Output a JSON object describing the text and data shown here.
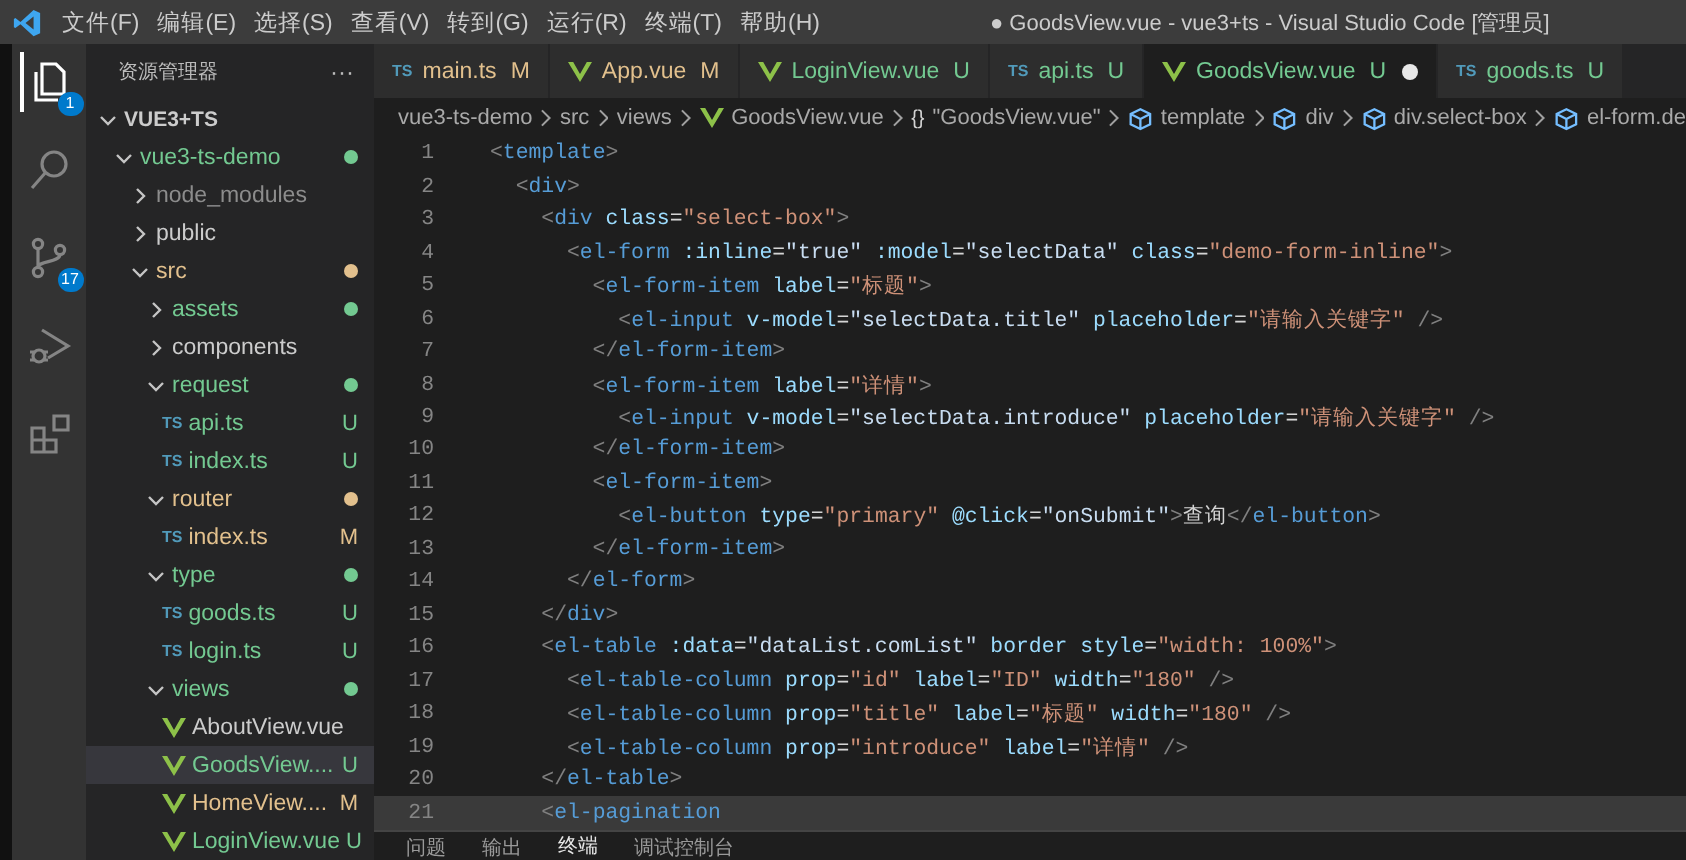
{
  "menu": [
    "文件(F)",
    "编辑(E)",
    "选择(S)",
    "查看(V)",
    "转到(G)",
    "运行(R)",
    "终端(T)",
    "帮助(H)"
  ],
  "window": {
    "title": "● GoodsView.vue - vue3+ts - Visual Studio Code [管理员]"
  },
  "activity_bar": [
    {
      "kind": "explorer",
      "badge": "1",
      "selected": true
    },
    {
      "kind": "search",
      "selected": false
    },
    {
      "kind": "source-control",
      "badge": "17",
      "selected": false
    },
    {
      "kind": "run",
      "selected": false
    },
    {
      "kind": "extensions",
      "selected": false
    }
  ],
  "explorer": {
    "title": "资源管理器",
    "more": "···",
    "tree": [
      {
        "name": "VUE3+TS",
        "kind": "root",
        "expanded": true,
        "selected": false,
        "children": [
          {
            "name": "vue3-ts-demo",
            "kind": "folder",
            "expanded": true,
            "color": "#73c991",
            "dot": true,
            "selected": false,
            "children": [
              {
                "name": "node_modules",
                "kind": "folder",
                "expanded": false,
                "color": "#8c8c8c",
                "dot": false,
                "selected": false
              },
              {
                "name": "public",
                "kind": "folder",
                "expanded": false,
                "color": "#cccccc",
                "dot": false,
                "selected": false
              },
              {
                "name": "src",
                "kind": "folder",
                "expanded": true,
                "color": "#e2c08d",
                "dot": true,
                "selected": false,
                "children": [
                  {
                    "name": "assets",
                    "kind": "folder",
                    "expanded": false,
                    "color": "#73c991",
                    "dot": true,
                    "selected": false
                  },
                  {
                    "name": "components",
                    "kind": "folder",
                    "expanded": false,
                    "color": "#cccccc",
                    "dot": false,
                    "selected": false
                  },
                  {
                    "name": "request",
                    "kind": "folder",
                    "expanded": true,
                    "color": "#73c991",
                    "dot": true,
                    "selected": false,
                    "children": [
                      {
                        "name": "api.ts",
                        "kind": "ts",
                        "icon_text": "TS",
                        "badge": "U",
                        "color": "#73c991",
                        "selected": false
                      },
                      {
                        "name": "index.ts",
                        "kind": "ts",
                        "icon_text": "TS",
                        "badge": "U",
                        "color": "#73c991",
                        "selected": false
                      }
                    ]
                  },
                  {
                    "name": "router",
                    "kind": "folder",
                    "expanded": true,
                    "color": "#e2c08d",
                    "dot": true,
                    "selected": false,
                    "children": [
                      {
                        "name": "index.ts",
                        "kind": "ts",
                        "icon_text": "TS",
                        "badge": "M",
                        "color": "#e2c08d",
                        "selected": false
                      }
                    ]
                  },
                  {
                    "name": "type",
                    "kind": "folder",
                    "expanded": true,
                    "color": "#73c991",
                    "dot": true,
                    "selected": false,
                    "children": [
                      {
                        "name": "goods.ts",
                        "kind": "ts",
                        "icon_text": "TS",
                        "badge": "U",
                        "color": "#73c991",
                        "selected": false
                      },
                      {
                        "name": "login.ts",
                        "kind": "ts",
                        "icon_text": "TS",
                        "badge": "U",
                        "color": "#73c991",
                        "selected": false
                      }
                    ]
                  },
                  {
                    "name": "views",
                    "kind": "folder",
                    "expanded": true,
                    "color": "#73c991",
                    "dot": true,
                    "selected": false,
                    "children": [
                      {
                        "name": "AboutView.vue",
                        "kind": "vue",
                        "color": "#cccccc",
                        "selected": false
                      },
                      {
                        "name": "GoodsView....",
                        "kind": "vue",
                        "badge": "U",
                        "color": "#73c991",
                        "selected": true
                      },
                      {
                        "name": "HomeView....",
                        "kind": "vue",
                        "badge": "M",
                        "color": "#e2c08d",
                        "selected": false
                      },
                      {
                        "name": "LoginView.vue",
                        "kind": "vue",
                        "badge": "U",
                        "color": "#73c991",
                        "selected": false
                      }
                    ]
                  }
                ]
              }
            ]
          }
        ]
      }
    ]
  },
  "tabs": [
    {
      "name": "main.ts",
      "kind": "ts",
      "icon_text": "TS",
      "badge": "M",
      "color": "#e2c08d",
      "selected": false,
      "modified": false
    },
    {
      "name": "App.vue",
      "kind": "vue",
      "badge": "M",
      "color": "#e2c08d",
      "selected": false,
      "modified": false
    },
    {
      "name": "LoginView.vue",
      "kind": "vue",
      "badge": "U",
      "color": "#73c991",
      "selected": false,
      "modified": false
    },
    {
      "name": "api.ts",
      "kind": "ts",
      "icon_text": "TS",
      "badge": "U",
      "color": "#73c991",
      "selected": false,
      "modified": false
    },
    {
      "name": "GoodsView.vue",
      "kind": "vue",
      "badge": "U",
      "color": "#73c991",
      "selected": true,
      "modified": true
    },
    {
      "name": "goods.ts",
      "kind": "ts",
      "icon_text": "TS",
      "badge": "U",
      "color": "#73c991",
      "selected": false,
      "modified": false
    }
  ],
  "breadcrumb": [
    {
      "text": "vue3-ts-demo",
      "kind": "plain"
    },
    {
      "text": "src",
      "kind": "plain"
    },
    {
      "text": "views",
      "kind": "plain"
    },
    {
      "text": "GoodsView.vue",
      "kind": "vue"
    },
    {
      "text": "\"GoodsView.vue\"",
      "kind": "braces",
      "icon_text": "{}"
    },
    {
      "text": "template",
      "kind": "element"
    },
    {
      "text": "div",
      "kind": "element"
    },
    {
      "text": "div.select-box",
      "kind": "element"
    },
    {
      "text": "el-form.de",
      "kind": "element"
    }
  ],
  "code": [
    {
      "number": "1",
      "highlighted": false,
      "tokens": [
        {
          "kind": "punct",
          "text": "<"
        },
        {
          "kind": "tag",
          "text": "template"
        },
        {
          "kind": "punct",
          "text": ">"
        }
      ]
    },
    {
      "number": "2",
      "highlighted": false,
      "tokens": [
        {
          "kind": "punct",
          "text": "  <"
        },
        {
          "kind": "tag",
          "text": "div"
        },
        {
          "kind": "punct",
          "text": ">"
        }
      ]
    },
    {
      "number": "3",
      "highlighted": false,
      "tokens": [
        {
          "kind": "punct",
          "text": "    <"
        },
        {
          "kind": "tag",
          "text": "div"
        },
        {
          "kind": "attr",
          "text": " class"
        },
        {
          "kind": "text",
          "text": "="
        },
        {
          "kind": "string",
          "text": "\"select-box\""
        },
        {
          "kind": "punct",
          "text": ">"
        }
      ]
    },
    {
      "number": "4",
      "highlighted": false,
      "tokens": [
        {
          "kind": "punct",
          "text": "      <"
        },
        {
          "kind": "tag",
          "text": "el-form"
        },
        {
          "kind": "attr",
          "text": " :inline"
        },
        {
          "kind": "text",
          "text": "="
        },
        {
          "kind": "expr",
          "text": "\"true\""
        },
        {
          "kind": "attr",
          "text": " :model"
        },
        {
          "kind": "text",
          "text": "="
        },
        {
          "kind": "expr",
          "text": "\"selectData\""
        },
        {
          "kind": "attr",
          "text": " class"
        },
        {
          "kind": "text",
          "text": "="
        },
        {
          "kind": "string",
          "text": "\"demo-form-inline\""
        },
        {
          "kind": "punct",
          "text": ">"
        }
      ]
    },
    {
      "number": "5",
      "highlighted": false,
      "tokens": [
        {
          "kind": "punct",
          "text": "        <"
        },
        {
          "kind": "tag",
          "text": "el-form-item"
        },
        {
          "kind": "attr",
          "text": " label"
        },
        {
          "kind": "text",
          "text": "="
        },
        {
          "kind": "string",
          "text": "\"标题\""
        },
        {
          "kind": "punct",
          "text": ">"
        }
      ]
    },
    {
      "number": "6",
      "highlighted": false,
      "tokens": [
        {
          "kind": "punct",
          "text": "          <"
        },
        {
          "kind": "tag",
          "text": "el-input"
        },
        {
          "kind": "attr",
          "text": " v-model"
        },
        {
          "kind": "text",
          "text": "="
        },
        {
          "kind": "expr",
          "text": "\"selectData.title\""
        },
        {
          "kind": "attr",
          "text": " placeholder"
        },
        {
          "kind": "text",
          "text": "="
        },
        {
          "kind": "string",
          "text": "\"请输入关键字\""
        },
        {
          "kind": "punct",
          "text": " />"
        }
      ]
    },
    {
      "number": "7",
      "highlighted": false,
      "tokens": [
        {
          "kind": "punct",
          "text": "        </"
        },
        {
          "kind": "tag",
          "text": "el-form-item"
        },
        {
          "kind": "punct",
          "text": ">"
        }
      ]
    },
    {
      "number": "8",
      "highlighted": false,
      "tokens": [
        {
          "kind": "punct",
          "text": "        <"
        },
        {
          "kind": "tag",
          "text": "el-form-item"
        },
        {
          "kind": "attr",
          "text": " label"
        },
        {
          "kind": "text",
          "text": "="
        },
        {
          "kind": "string",
          "text": "\"详情\""
        },
        {
          "kind": "punct",
          "text": ">"
        }
      ]
    },
    {
      "number": "9",
      "highlighted": false,
      "tokens": [
        {
          "kind": "punct",
          "text": "          <"
        },
        {
          "kind": "tag",
          "text": "el-input"
        },
        {
          "kind": "attr",
          "text": " v-model"
        },
        {
          "kind": "text",
          "text": "="
        },
        {
          "kind": "expr",
          "text": "\"selectData.introduce\""
        },
        {
          "kind": "attr",
          "text": " placeholder"
        },
        {
          "kind": "text",
          "text": "="
        },
        {
          "kind": "string",
          "text": "\"请输入关键字\""
        },
        {
          "kind": "punct",
          "text": " />"
        }
      ]
    },
    {
      "number": "10",
      "highlighted": false,
      "tokens": [
        {
          "kind": "punct",
          "text": "        </"
        },
        {
          "kind": "tag",
          "text": "el-form-item"
        },
        {
          "kind": "punct",
          "text": ">"
        }
      ]
    },
    {
      "number": "11",
      "highlighted": false,
      "tokens": [
        {
          "kind": "punct",
          "text": "        <"
        },
        {
          "kind": "tag",
          "text": "el-form-item"
        },
        {
          "kind": "punct",
          "text": ">"
        }
      ]
    },
    {
      "number": "12",
      "highlighted": false,
      "tokens": [
        {
          "kind": "punct",
          "text": "          <"
        },
        {
          "kind": "tag",
          "text": "el-button"
        },
        {
          "kind": "attr",
          "text": " type"
        },
        {
          "kind": "text",
          "text": "="
        },
        {
          "kind": "string",
          "text": "\"primary\""
        },
        {
          "kind": "attr",
          "text": " @click"
        },
        {
          "kind": "text",
          "text": "="
        },
        {
          "kind": "expr",
          "text": "\"onSubmit\""
        },
        {
          "kind": "punct",
          "text": ">"
        },
        {
          "kind": "text",
          "text": "查询"
        },
        {
          "kind": "punct",
          "text": "</"
        },
        {
          "kind": "tag",
          "text": "el-button"
        },
        {
          "kind": "punct",
          "text": ">"
        }
      ]
    },
    {
      "number": "13",
      "highlighted": false,
      "tokens": [
        {
          "kind": "punct",
          "text": "        </"
        },
        {
          "kind": "tag",
          "text": "el-form-item"
        },
        {
          "kind": "punct",
          "text": ">"
        }
      ]
    },
    {
      "number": "14",
      "highlighted": false,
      "tokens": [
        {
          "kind": "punct",
          "text": "      </"
        },
        {
          "kind": "tag",
          "text": "el-form"
        },
        {
          "kind": "punct",
          "text": ">"
        }
      ]
    },
    {
      "number": "15",
      "highlighted": false,
      "tokens": [
        {
          "kind": "punct",
          "text": "    </"
        },
        {
          "kind": "tag",
          "text": "div"
        },
        {
          "kind": "punct",
          "text": ">"
        }
      ]
    },
    {
      "number": "16",
      "highlighted": false,
      "tokens": [
        {
          "kind": "punct",
          "text": "    <"
        },
        {
          "kind": "tag",
          "text": "el-table"
        },
        {
          "kind": "attr",
          "text": " :data"
        },
        {
          "kind": "text",
          "text": "="
        },
        {
          "kind": "expr",
          "text": "\"dataList.comList\""
        },
        {
          "kind": "attr",
          "text": " border"
        },
        {
          "kind": "attr",
          "text": " style"
        },
        {
          "kind": "text",
          "text": "="
        },
        {
          "kind": "string",
          "text": "\"width: 100%\""
        },
        {
          "kind": "punct",
          "text": ">"
        }
      ]
    },
    {
      "number": "17",
      "highlighted": false,
      "tokens": [
        {
          "kind": "punct",
          "text": "      <"
        },
        {
          "kind": "tag",
          "text": "el-table-column"
        },
        {
          "kind": "attr",
          "text": " prop"
        },
        {
          "kind": "text",
          "text": "="
        },
        {
          "kind": "string",
          "text": "\"id\""
        },
        {
          "kind": "attr",
          "text": " label"
        },
        {
          "kind": "text",
          "text": "="
        },
        {
          "kind": "string",
          "text": "\"ID\""
        },
        {
          "kind": "attr",
          "text": " width"
        },
        {
          "kind": "text",
          "text": "="
        },
        {
          "kind": "string",
          "text": "\"180\""
        },
        {
          "kind": "punct",
          "text": " />"
        }
      ]
    },
    {
      "number": "18",
      "highlighted": false,
      "tokens": [
        {
          "kind": "punct",
          "text": "      <"
        },
        {
          "kind": "tag",
          "text": "el-table-column"
        },
        {
          "kind": "attr",
          "text": " prop"
        },
        {
          "kind": "text",
          "text": "="
        },
        {
          "kind": "string",
          "text": "\"title\""
        },
        {
          "kind": "attr",
          "text": " label"
        },
        {
          "kind": "text",
          "text": "="
        },
        {
          "kind": "string",
          "text": "\"标题\""
        },
        {
          "kind": "attr",
          "text": " width"
        },
        {
          "kind": "text",
          "text": "="
        },
        {
          "kind": "string",
          "text": "\"180\""
        },
        {
          "kind": "punct",
          "text": " />"
        }
      ]
    },
    {
      "number": "19",
      "highlighted": false,
      "tokens": [
        {
          "kind": "punct",
          "text": "      <"
        },
        {
          "kind": "tag",
          "text": "el-table-column"
        },
        {
          "kind": "attr",
          "text": " prop"
        },
        {
          "kind": "text",
          "text": "="
        },
        {
          "kind": "string",
          "text": "\"introduce\""
        },
        {
          "kind": "attr",
          "text": " label"
        },
        {
          "kind": "text",
          "text": "="
        },
        {
          "kind": "string",
          "text": "\"详情\""
        },
        {
          "kind": "punct",
          "text": " />"
        }
      ]
    },
    {
      "number": "20",
      "highlighted": false,
      "tokens": [
        {
          "kind": "punct",
          "text": "    </"
        },
        {
          "kind": "tag",
          "text": "el-table"
        },
        {
          "kind": "punct",
          "text": ">"
        }
      ]
    },
    {
      "number": "21",
      "highlighted": true,
      "tokens": [
        {
          "kind": "punct",
          "text": "    <"
        },
        {
          "kind": "tag",
          "text": "el-pagination"
        }
      ]
    }
  ],
  "panel_tabs": [
    {
      "label": "问题",
      "selected": false
    },
    {
      "label": "输出",
      "selected": false
    },
    {
      "label": "终端",
      "selected": true
    },
    {
      "label": "调试控制台",
      "selected": false
    }
  ]
}
